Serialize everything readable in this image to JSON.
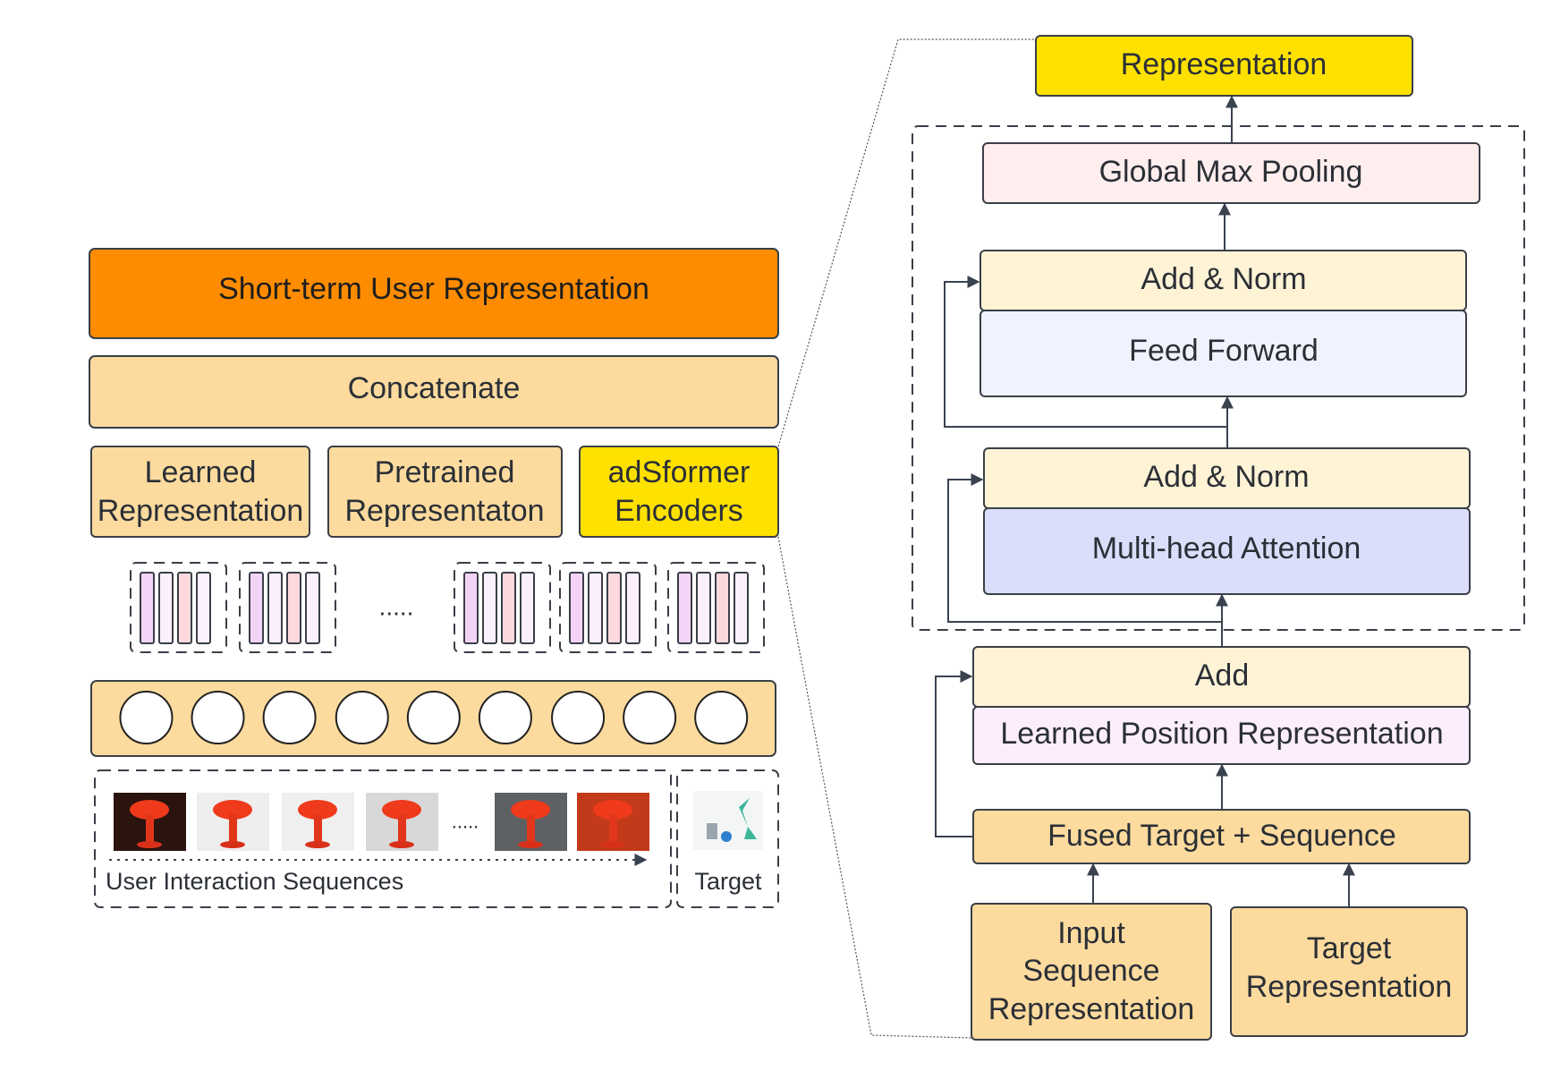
{
  "left": {
    "title": "Short-term User Representation",
    "concat": "Concatenate",
    "learned": [
      "Learned",
      "Representation"
    ],
    "pretrained": [
      "Pretrained",
      "Representaton"
    ],
    "adsformer": [
      "adSformer",
      "Encoders"
    ],
    "ellipsis": ".....",
    "images_ellipsis": ".....",
    "sequence_label": "User Interaction Sequences",
    "target_label": "Target"
  },
  "right": {
    "representation": "Representation",
    "gmp": "Global Max Pooling",
    "addnorm1": "Add & Norm",
    "ff": "Feed Forward",
    "addnorm2": "Add & Norm",
    "mha": "Multi-head Attention",
    "add": "Add",
    "lpr": "Learned Position Representation",
    "fused": "Fused Target + Sequence",
    "input": [
      "Input",
      "Sequence",
      "Representation"
    ],
    "target": [
      "Target",
      "Representation"
    ]
  },
  "colors": {
    "orange": "#FF8C00",
    "light_orange": "#FDDB9E",
    "yellow": "#FFE100",
    "cream": "#FFF3D6",
    "pink": "#FFEEEE",
    "lavender": "#F0F2FD",
    "blue": "#DADEFA",
    "light_pink": "#FCEEFD"
  }
}
